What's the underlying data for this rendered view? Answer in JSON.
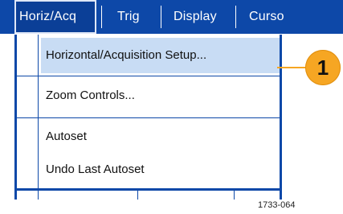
{
  "menubar": {
    "items": [
      {
        "label": "Horiz/Acq",
        "active": true
      },
      {
        "label": "Trig"
      },
      {
        "label": "Display"
      },
      {
        "label": "Curso"
      }
    ]
  },
  "dropdown": {
    "items": [
      {
        "label": "Horizontal/Acquisition Setup...",
        "selected": true
      },
      {
        "label": "Zoom Controls..."
      },
      {
        "label": "Autoset"
      },
      {
        "label": "Undo Last Autoset"
      }
    ]
  },
  "callout": {
    "number": "1",
    "color": "#f6a623"
  },
  "figure_id": "1733-064",
  "colors": {
    "menubar": "#0d48a8",
    "selection": "#c8dcf4",
    "callout": "#f6a623"
  }
}
